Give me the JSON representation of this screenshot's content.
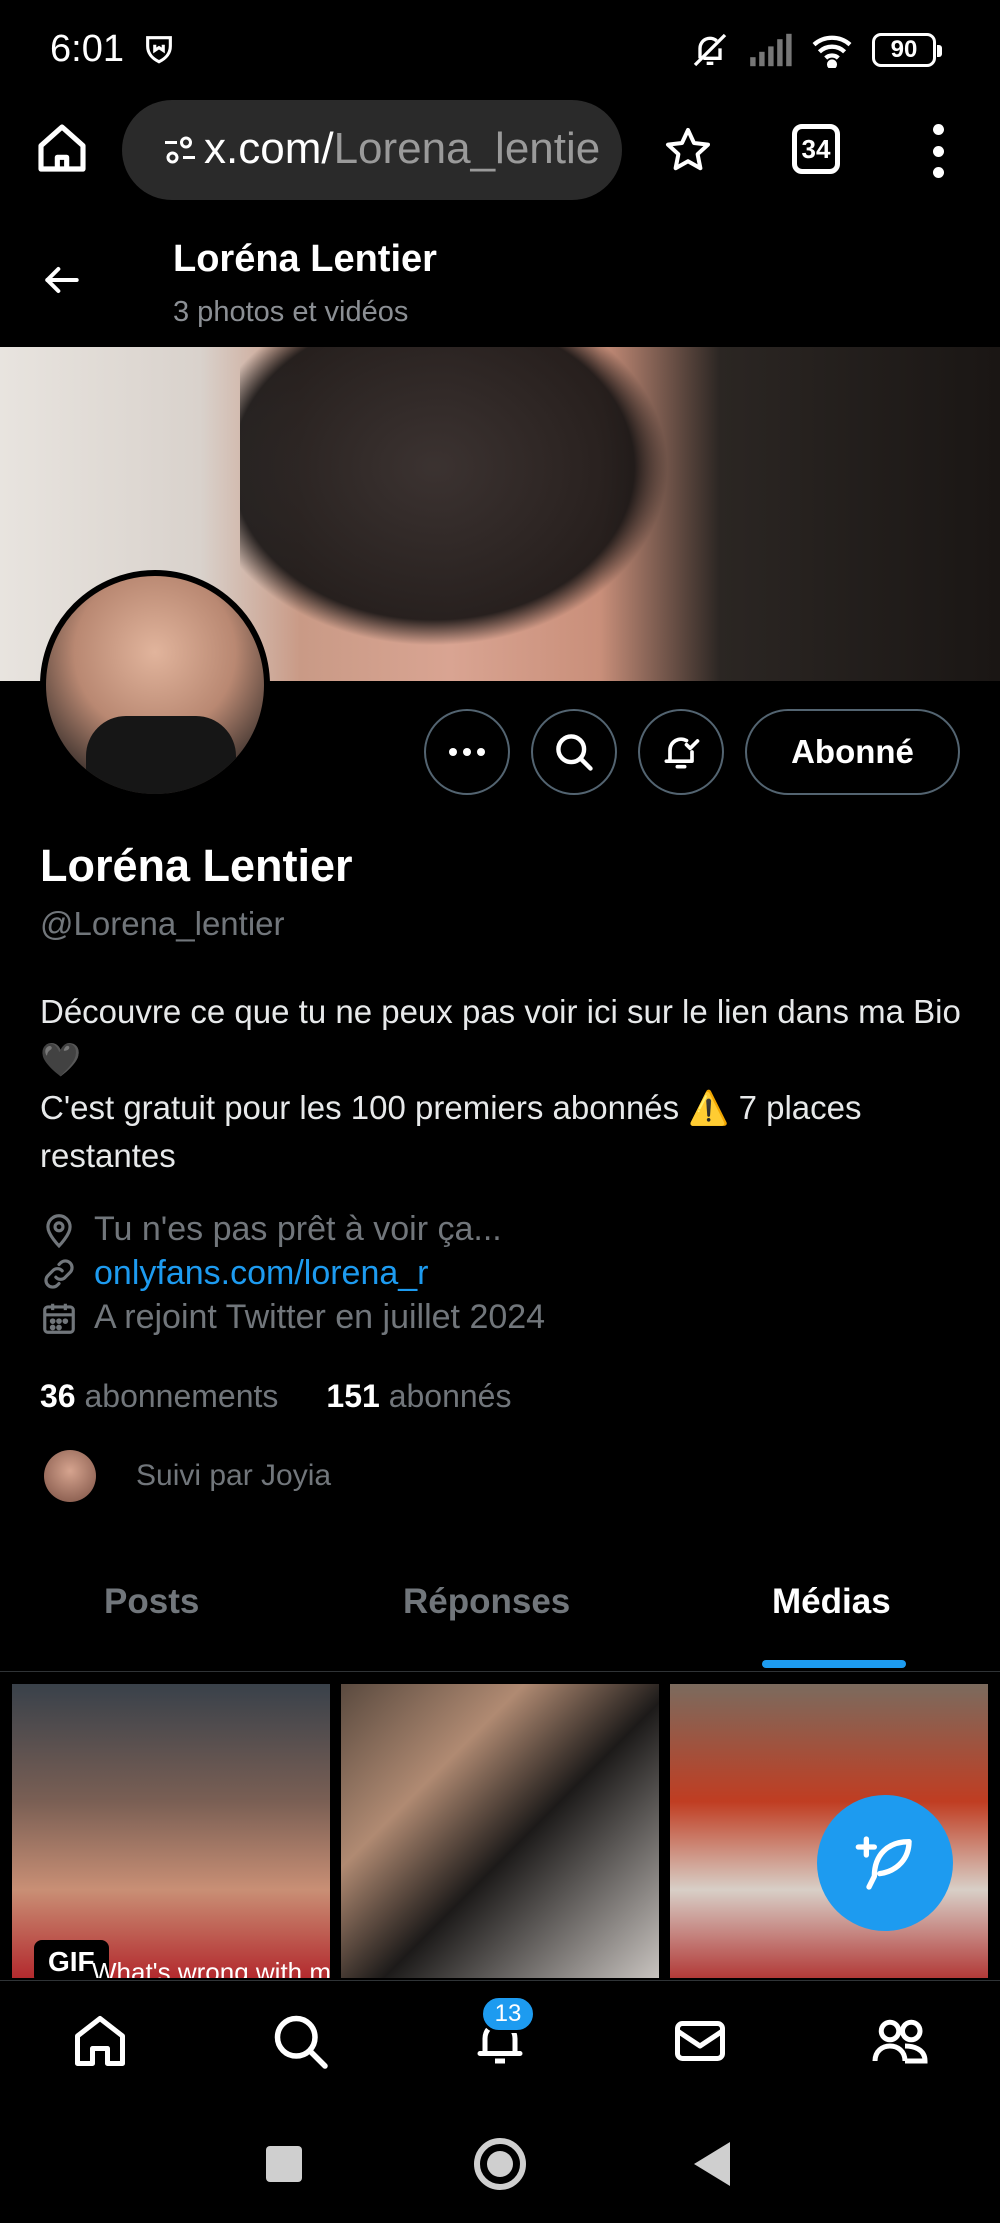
{
  "status_bar": {
    "time": "6:01",
    "battery": "90"
  },
  "browser": {
    "url_host": "x.com/",
    "url_path": "Lorena_lentie",
    "tab_count": "34"
  },
  "header": {
    "name": "Loréna Lentier",
    "subtitle": "3 photos et vidéos"
  },
  "actions": {
    "follow_label": "Abonné"
  },
  "profile": {
    "name": "Loréna Lentier",
    "handle": "@Lorena_lentier",
    "bio_line1": "Découvre ce que tu ne peux pas voir ici sur le lien dans ma Bio 🖤",
    "bio_line2": "C'est gratuit pour les 100 premiers abonnés ⚠️ 7 places restantes",
    "location": "Tu n'es pas prêt à voir ça...",
    "link": "onlyfans.com/lorena_r",
    "joined": "A rejoint Twitter en juillet 2024",
    "following_count": "36",
    "following_label": "abonnements",
    "followers_count": "151",
    "followers_label": "abonnés",
    "followed_by": "Suivi par Joyia"
  },
  "tabs": [
    {
      "label": "Posts"
    },
    {
      "label": "Réponses"
    },
    {
      "label": "Médias"
    }
  ],
  "media": {
    "gif_label": "GIF",
    "gif_caption": "What's wrong with me?"
  },
  "bottom_nav": {
    "notif_badge": "13"
  },
  "colors": {
    "accent": "#1d9bf0",
    "background": "#000000",
    "muted": "#71767b"
  }
}
